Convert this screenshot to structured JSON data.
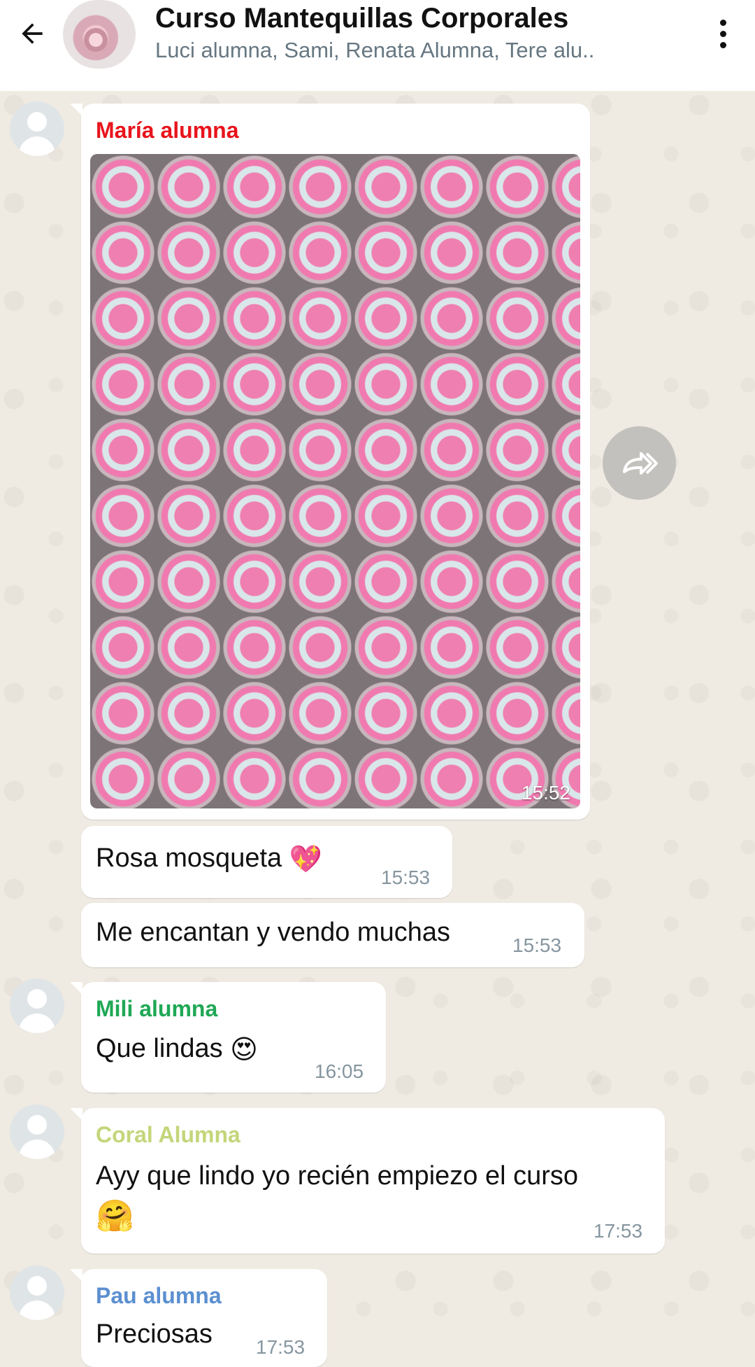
{
  "header": {
    "back_icon": "arrow-left-icon",
    "title": "Curso Mantequillas Corporales",
    "subtitle": "Luci alumna, Sami, Renata Alumna, Tere alu..",
    "menu_icon": "more-vertical-icon"
  },
  "messages": [
    {
      "sender": "María alumna",
      "sender_color": "#e8141c",
      "type": "image",
      "time": "15:52",
      "forward_icon": "forward-icon"
    },
    {
      "text": "Rosa mosqueta",
      "emoji": "💖",
      "time": "15:53"
    },
    {
      "text": "Me encantan y vendo muchas",
      "time": "15:53"
    },
    {
      "sender": "Mili alumna",
      "sender_color": "#1fa855",
      "text": "Que lindas",
      "emoji": "😍",
      "time": "16:05"
    },
    {
      "sender": "Coral Alumna",
      "sender_color": "#c3d67a",
      "text": "Ayy que lindo yo recién empiezo el curso",
      "emoji": "🤗",
      "time": "17:53"
    },
    {
      "sender": "Pau alumna",
      "sender_color": "#5b8fd0",
      "text": "Preciosas",
      "time": "17:53"
    }
  ]
}
